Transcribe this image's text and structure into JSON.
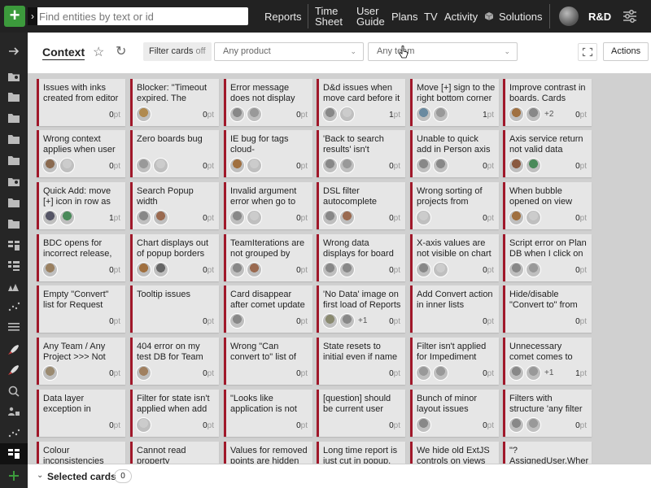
{
  "topbar": {
    "search_placeholder": "Find entities by text or id",
    "nav": [
      "Reports",
      "Time Sheet",
      "User Guide",
      "Plans",
      "TV",
      "Activity",
      "Solutions"
    ],
    "team": "R&D"
  },
  "header": {
    "title": "Context",
    "filter_cards": "Filter cards",
    "filter_state": "off",
    "product_dropdown": "Any product",
    "team_dropdown": "Any team",
    "actions": "Actions"
  },
  "bottom": {
    "label": "Selected cards",
    "count": "0"
  },
  "cards": [
    [
      {
        "title": "Issues with inks created from editor",
        "pts": "0",
        "avatars": []
      },
      {
        "title": "Wrong context applies when user",
        "pts": "0",
        "avatars": [
          "#8a6a50",
          "#ccc"
        ]
      },
      {
        "title": "Quick Add: move [+] icon in row as",
        "pts": "1",
        "avatars": [
          "#556",
          "#4a8a5a"
        ]
      },
      {
        "title": "BDC opens for incorrect release,",
        "pts": "0",
        "avatars": [
          "#9a8060"
        ]
      },
      {
        "title": "Empty \"Convert\" list for Request",
        "pts": "0",
        "avatars": []
      },
      {
        "title": "Any Team / Any Project >>> Not",
        "pts": "0",
        "avatars": [
          "#9a8a70"
        ]
      },
      {
        "title": "Data layer exception in",
        "pts": "0",
        "avatars": []
      },
      {
        "title": "Colour inconsistencies",
        "pts": "0",
        "avatars": []
      }
    ],
    [
      {
        "title": "Blocker: \"Timeout expired. The",
        "pts": "0",
        "avatars": [
          "#b08a50"
        ]
      },
      {
        "title": "Zero boards bug",
        "pts": "0",
        "avatars": [
          "#999",
          "#ccc"
        ]
      },
      {
        "title": "Search Popup width",
        "pts": "0",
        "avatars": [
          "#888",
          "#9a6a50"
        ]
      },
      {
        "title": "Chart displays out of popup borders",
        "pts": "0",
        "avatars": [
          "#a07040",
          "#666"
        ]
      },
      {
        "title": "Tooltip issues",
        "pts": "0",
        "avatars": []
      },
      {
        "title": "404 error on my test DB for Team",
        "pts": "0",
        "avatars": [
          "#a08060"
        ]
      },
      {
        "title": "Filter for state isn't applied when add",
        "pts": "0",
        "avatars": [
          "#ccc"
        ]
      },
      {
        "title": "Cannot read property",
        "pts": "0",
        "avatars": []
      }
    ],
    [
      {
        "title": "Error message does not display and JS",
        "pts": "0",
        "avatars": [
          "#888",
          "#999"
        ]
      },
      {
        "title": "IE bug for tags cloud-",
        "pts": "0",
        "avatars": [
          "#a07040",
          "#ccc"
        ]
      },
      {
        "title": "Invalid argument error when go to",
        "pts": "0",
        "avatars": [
          "#888",
          "#ccc"
        ]
      },
      {
        "title": "TeamIterations are not grouped by",
        "pts": "0",
        "avatars": [
          "#888",
          "#9a6a50"
        ]
      },
      {
        "title": "Card disappear after comet update",
        "pts": "0",
        "avatars": [
          "#888"
        ]
      },
      {
        "title": "Wrong \"Can convert to\" list of",
        "pts": "0",
        "avatars": []
      },
      {
        "title": "\"Looks like application is not",
        "pts": "0",
        "avatars": []
      },
      {
        "title": "Values for removed points are hidden",
        "pts": "0",
        "avatars": []
      }
    ],
    [
      {
        "title": "D&d issues when move card before it",
        "pts": "1",
        "avatars": [
          "#888",
          "#ccc"
        ]
      },
      {
        "title": "'Back to search results' isn't",
        "pts": "0",
        "avatars": [
          "#888",
          "#999"
        ]
      },
      {
        "title": "DSL filter autocomplete",
        "pts": "0",
        "avatars": [
          "#888",
          "#9a6a50"
        ]
      },
      {
        "title": "Wrong data displays for board",
        "pts": "0",
        "avatars": [
          "#888",
          "#888"
        ]
      },
      {
        "title": "'No Data' image on first load of Reports",
        "pts": "0",
        "avatars": [
          "#8a8a70",
          "#888"
        ],
        "plus": "+1"
      },
      {
        "title": "State resets to initial even if name",
        "pts": "0",
        "avatars": []
      },
      {
        "title": "[question] should be current user",
        "pts": "0",
        "avatars": []
      },
      {
        "title": "Long time report is just cut in popup.",
        "pts": "0",
        "avatars": []
      }
    ],
    [
      {
        "title": "Move [+] sign to the right bottom corner",
        "pts": "1",
        "avatars": [
          "#6a8aa0",
          "#999"
        ]
      },
      {
        "title": "Unable to quick add in Person axis",
        "pts": "0",
        "avatars": [
          "#888",
          "#888"
        ]
      },
      {
        "title": "Wrong sorting of projects from",
        "pts": "0",
        "avatars": [
          "#ccc"
        ]
      },
      {
        "title": "X-axis values are not visible on chart",
        "pts": "0",
        "avatars": [
          "#888",
          "#ccc"
        ]
      },
      {
        "title": "Add Convert action in inner lists",
        "pts": "0",
        "avatars": []
      },
      {
        "title": "Filter isn't applied for Impediment",
        "pts": "0",
        "avatars": [
          "#999",
          "#999"
        ]
      },
      {
        "title": "Bunch of minor layout issues",
        "pts": "0",
        "avatars": [
          "#888"
        ]
      },
      {
        "title": "We hide old ExtJS controls on views",
        "pts": "0",
        "avatars": []
      }
    ],
    [
      {
        "title": "Improve contrast in boards. Cards",
        "pts": "0",
        "avatars": [
          "#a07040",
          "#888"
        ],
        "plus": "+2"
      },
      {
        "title": "Axis service return not valid data",
        "pts": "0",
        "avatars": [
          "#8a5a40",
          "#4a8a5a"
        ]
      },
      {
        "title": "When bubble opened on view",
        "pts": "0",
        "avatars": [
          "#a07040",
          "#ccc"
        ]
      },
      {
        "title": "Script error on Plan DB when I click on",
        "pts": "0",
        "avatars": [
          "#888",
          "#999"
        ]
      },
      {
        "title": "Hide/disable \"Convert to\" from",
        "pts": "0",
        "avatars": []
      },
      {
        "title": "Unnecessary comet comes to user",
        "pts": "1",
        "avatars": [
          "#888",
          "#999"
        ],
        "plus": "+1"
      },
      {
        "title": "Filters with structure 'any filter",
        "pts": "0",
        "avatars": [
          "#888",
          "#999"
        ]
      },
      {
        "title": "\"? AssignedUser.Where",
        "pts": "0",
        "avatars": []
      }
    ]
  ]
}
